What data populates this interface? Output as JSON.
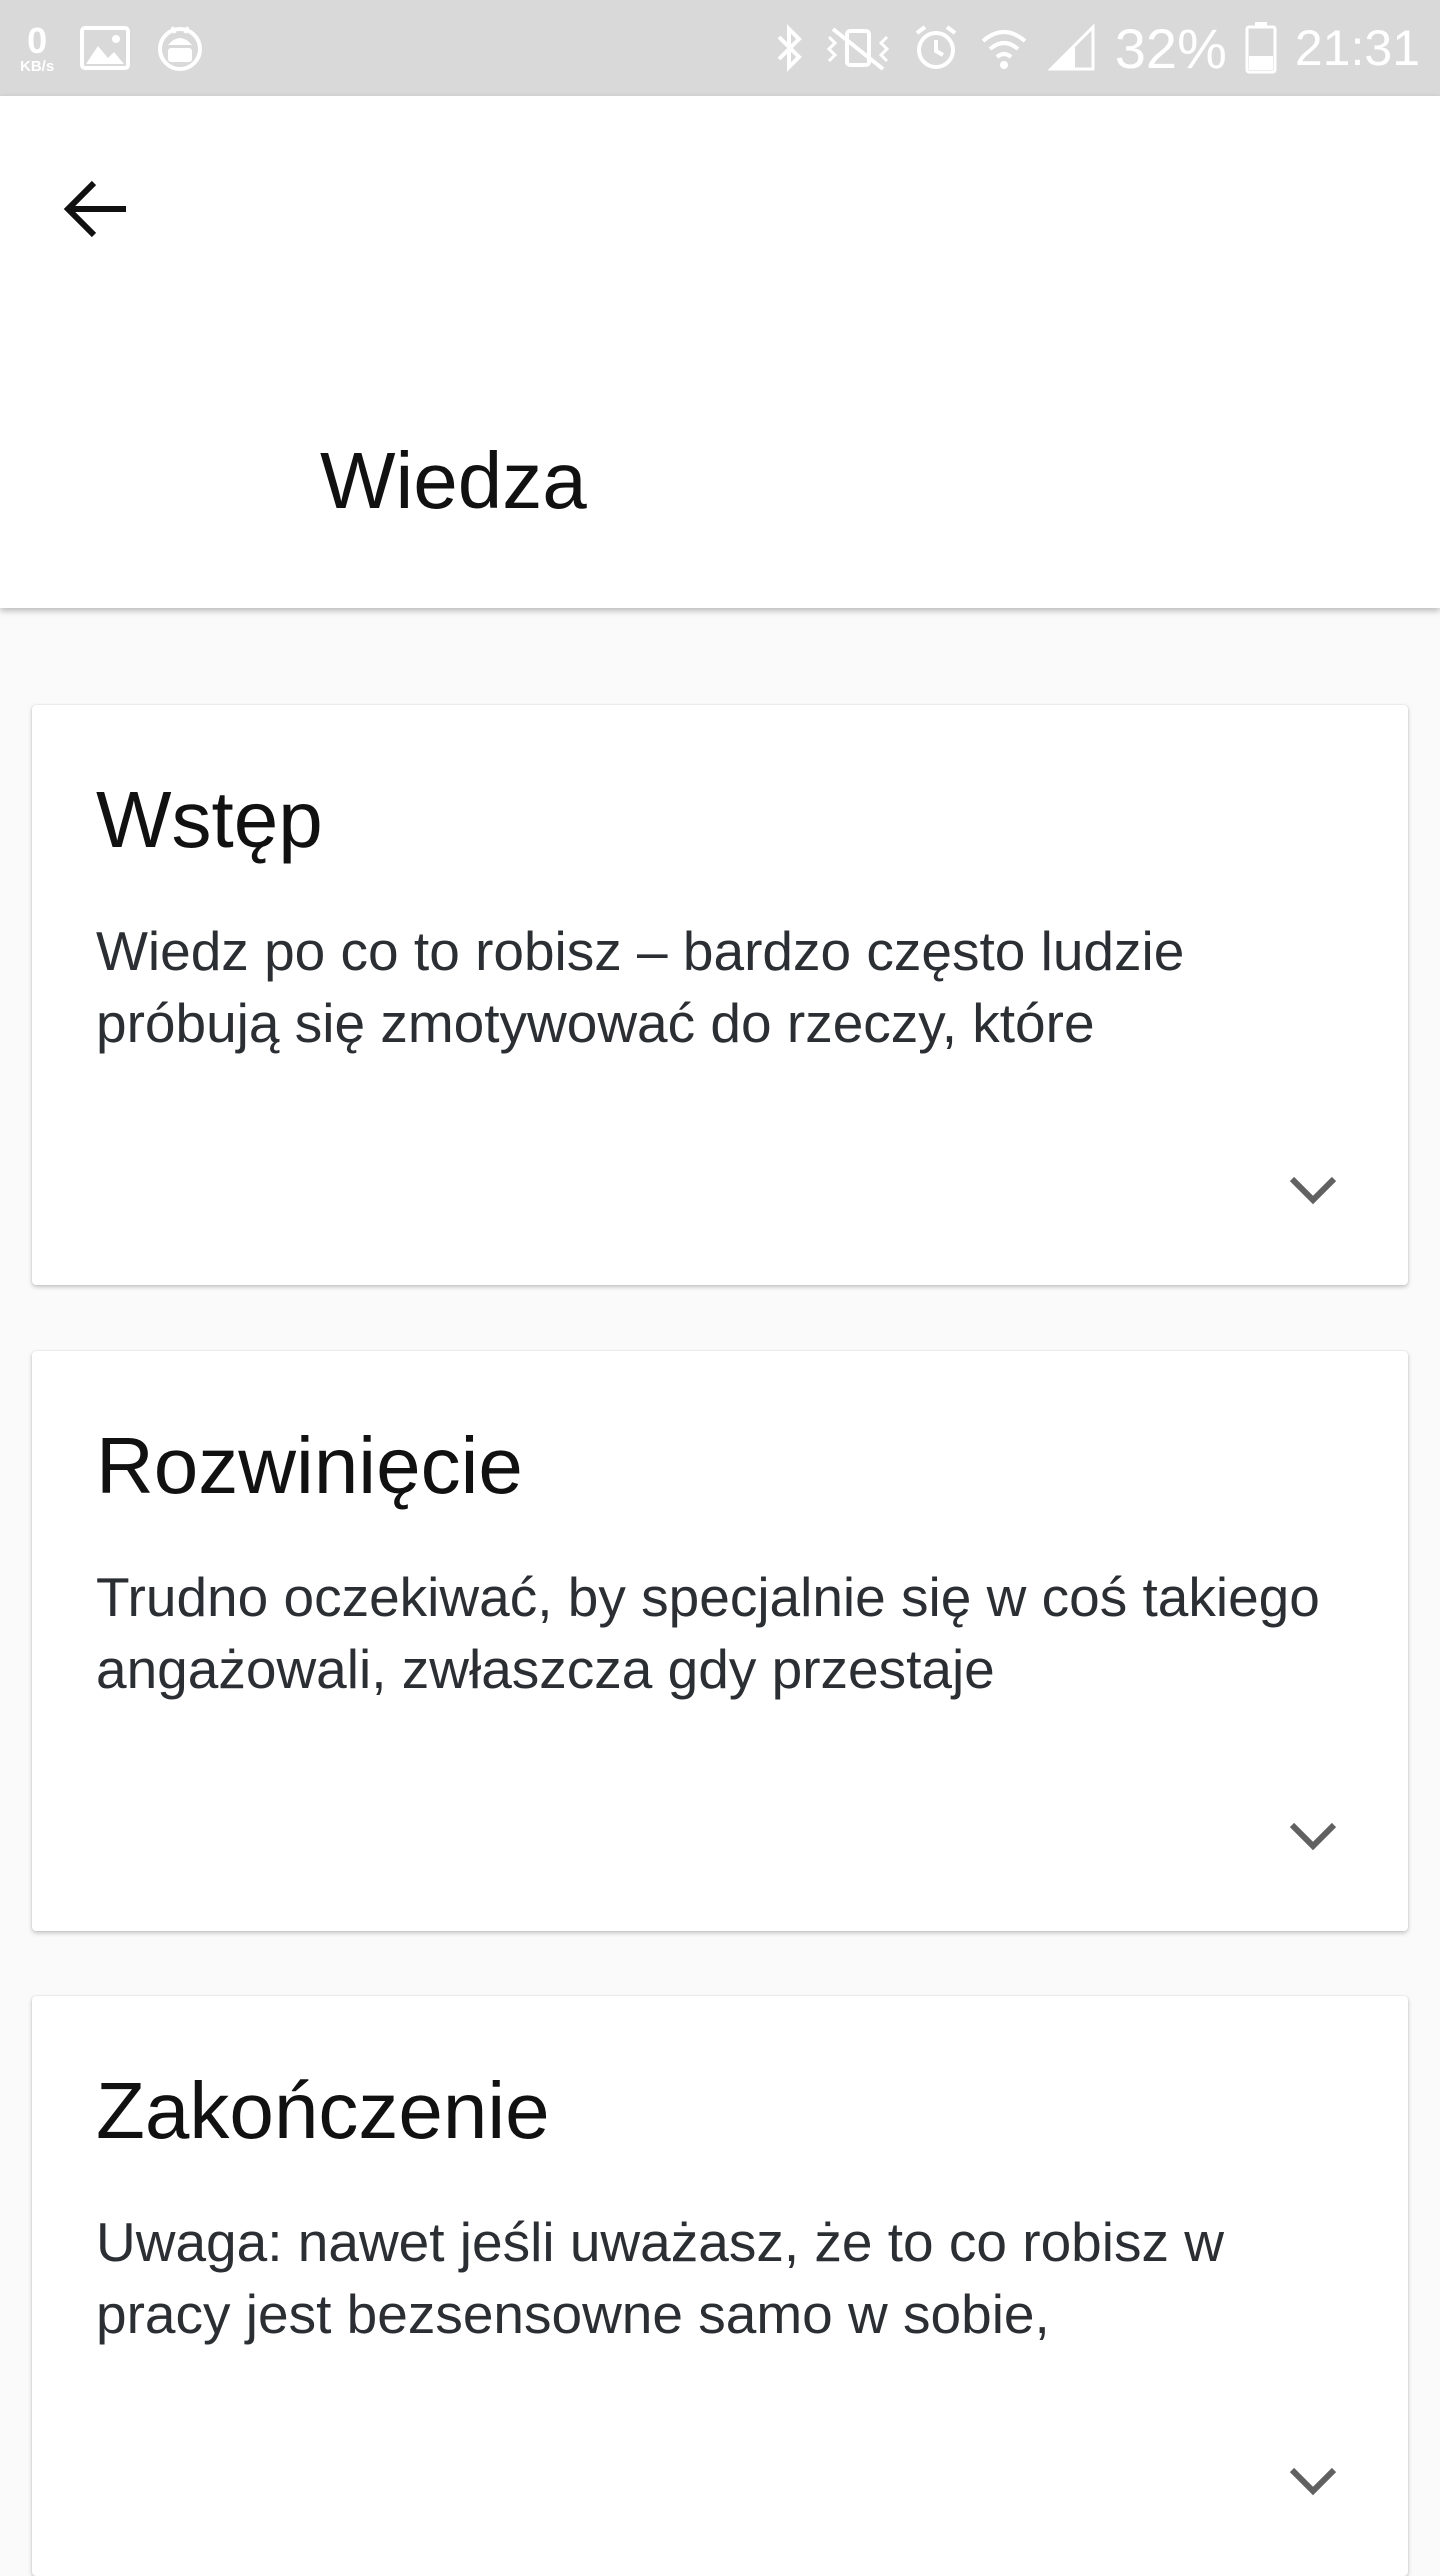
{
  "status_bar": {
    "speed_value": "0",
    "speed_unit": "KB/s",
    "battery": "32%",
    "time": "21:31"
  },
  "app_bar": {
    "back_icon": "arrow-left-icon",
    "title": "Wiedza"
  },
  "cards": [
    {
      "title": "Wstęp",
      "excerpt": "Wiedz po co to robisz – bardzo często ludzie próbują się zmotywować do rzeczy, które",
      "expand_icon": "chevron-down-icon"
    },
    {
      "title": "Rozwinięcie",
      "excerpt": "Trudno oczekiwać, by specjalnie się w coś takiego angażowali, zwłaszcza gdy przestaje",
      "expand_icon": "chevron-down-icon"
    },
    {
      "title": "Zakończenie",
      "excerpt": "Uwaga: nawet jeśli uważasz, że to co robisz w pracy jest bezsensowne samo w sobie,",
      "expand_icon": "chevron-down-icon"
    }
  ],
  "colors": {
    "status_bar_bg": "#d9d9d9",
    "background": "#fafafa",
    "card_bg": "#ffffff",
    "text_primary": "#111111",
    "text_secondary": "#2b2f33",
    "chevron": "#616161"
  }
}
